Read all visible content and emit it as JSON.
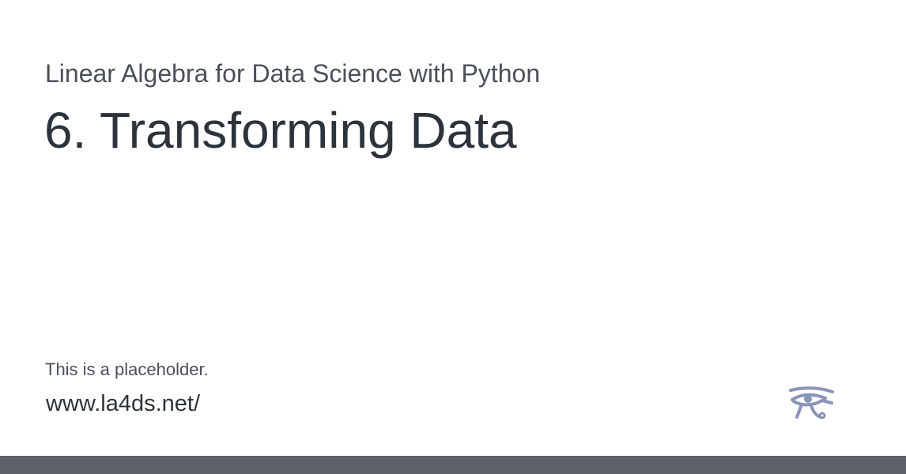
{
  "card": {
    "book_title": "Linear Algebra for Data Science with Python",
    "chapter_title": "6. Transforming Data",
    "description": "This is a placeholder.",
    "site_url": "www.la4ds.net/",
    "logo_icon": "eye-of-horus-icon"
  },
  "colors": {
    "background": "#ffffff",
    "heading": "#2d333b",
    "muted_text": "#4b5058",
    "logo": "#8a93b8",
    "footer_bar": "#5c616b"
  }
}
